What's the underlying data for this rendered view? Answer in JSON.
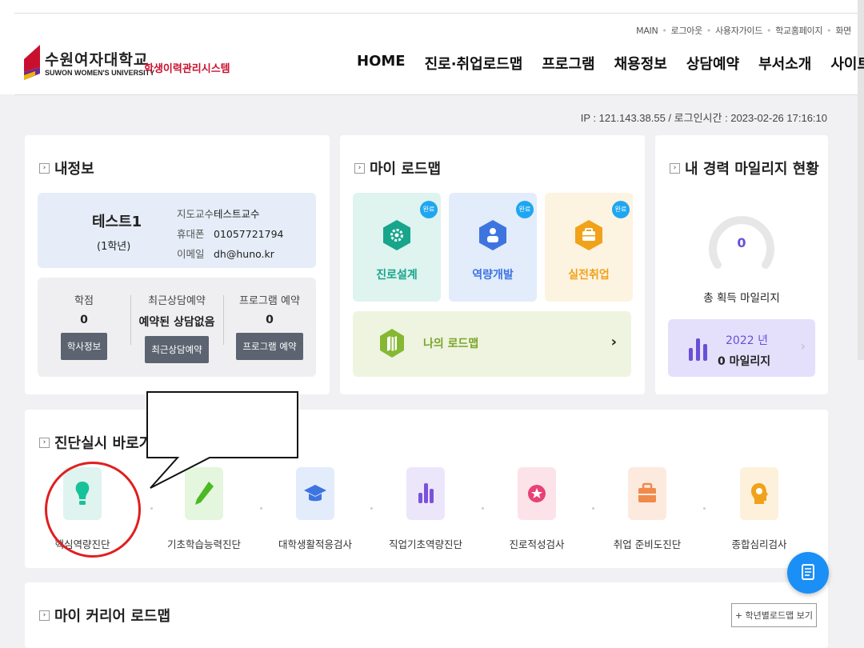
{
  "utility_links": [
    "MAIN",
    "로그아웃",
    "사용자가이드",
    "학교홈페이지",
    "화면"
  ],
  "logo": {
    "name_ko": "수원여자대학교",
    "name_en": "SUWON WOMEN'S UNIVERSITY",
    "system_name": "학생이력관리시스템"
  },
  "gnb": [
    "HOME",
    "진로·취업로드맵",
    "프로그램",
    "채용정보",
    "상담예약",
    "부서소개",
    "사이트맵"
  ],
  "session": {
    "ip_label": "IP : 121.143.38.55 / 로그인시간 : 2023-02-26 17:16:10"
  },
  "my_info": {
    "title": "내정보",
    "name": "테스트1",
    "grade": "(1학년)",
    "advisor_label": "지도교수",
    "advisor": "테스트교수",
    "phone_label": "휴대폰",
    "phone": "01057721794",
    "email_label": "이메일",
    "email": "dh@huno.kr",
    "stats": [
      {
        "title": "학점",
        "value": "0",
        "button": "학사정보"
      },
      {
        "title": "최근상담예약",
        "value": "예약된 상담없음",
        "button": "최근상담예약"
      },
      {
        "title": "프로그램 예약",
        "value": "0",
        "button": "프로그램 예약"
      }
    ]
  },
  "my_roadmap": {
    "title": "마이 로드맵",
    "tiles": [
      {
        "label": "진로설계",
        "badge": "완료",
        "bg": "#dff3ef",
        "color": "#17a58c",
        "icon": "gear-icon"
      },
      {
        "label": "역량개발",
        "badge": "완료",
        "bg": "#e3ecfb",
        "color": "#3d74e0",
        "icon": "person-icon"
      },
      {
        "label": "실전취업",
        "badge": "완료",
        "bg": "#fdf3e1",
        "color": "#f0a21a",
        "icon": "briefcase-icon"
      }
    ],
    "my_roadmap_label": "나의 로드맵",
    "arrow": "›"
  },
  "mileage": {
    "title": "내 경력 마일리지 현황",
    "total_value": "0",
    "total_label": "총 획득 마일리지",
    "year": "2022 년",
    "year_value": "0 마일리지",
    "arrow": "›"
  },
  "diagnosis": {
    "title": "진단실시 바로가기",
    "items": [
      {
        "label": "핵심역량진단",
        "bg": "#dff3ef",
        "color": "#17c29a",
        "icon": "lightbulb-icon"
      },
      {
        "label": "기초학습능력진단",
        "bg": "#e4f6dd",
        "color": "#4cb823",
        "icon": "pencil-icon"
      },
      {
        "label": "대학생활적응검사",
        "bg": "#e3ecfb",
        "color": "#3d74e0",
        "icon": "graduation-cap-icon"
      },
      {
        "label": "직업기초역량진단",
        "bg": "#ece6fb",
        "color": "#7b52dc",
        "icon": "bar-chart-icon"
      },
      {
        "label": "진로적성검사",
        "bg": "#fce3ea",
        "color": "#e84275",
        "icon": "star-icon"
      },
      {
        "label": "취업 준비도진단",
        "bg": "#fdeadf",
        "color": "#f08a4b",
        "icon": "briefcase-icon"
      },
      {
        "label": "종합심리검사",
        "bg": "#fdf1dc",
        "color": "#f0a21a",
        "icon": "head-icon"
      }
    ]
  },
  "career_roadmap": {
    "title": "마이 커리어 로드맵",
    "yearly_button": "+ 학년별로드맵 보기"
  },
  "colors": {
    "accent_red": "#c8102e",
    "fab_blue": "#1a8ff5",
    "highlight_red": "#e01f1f"
  }
}
